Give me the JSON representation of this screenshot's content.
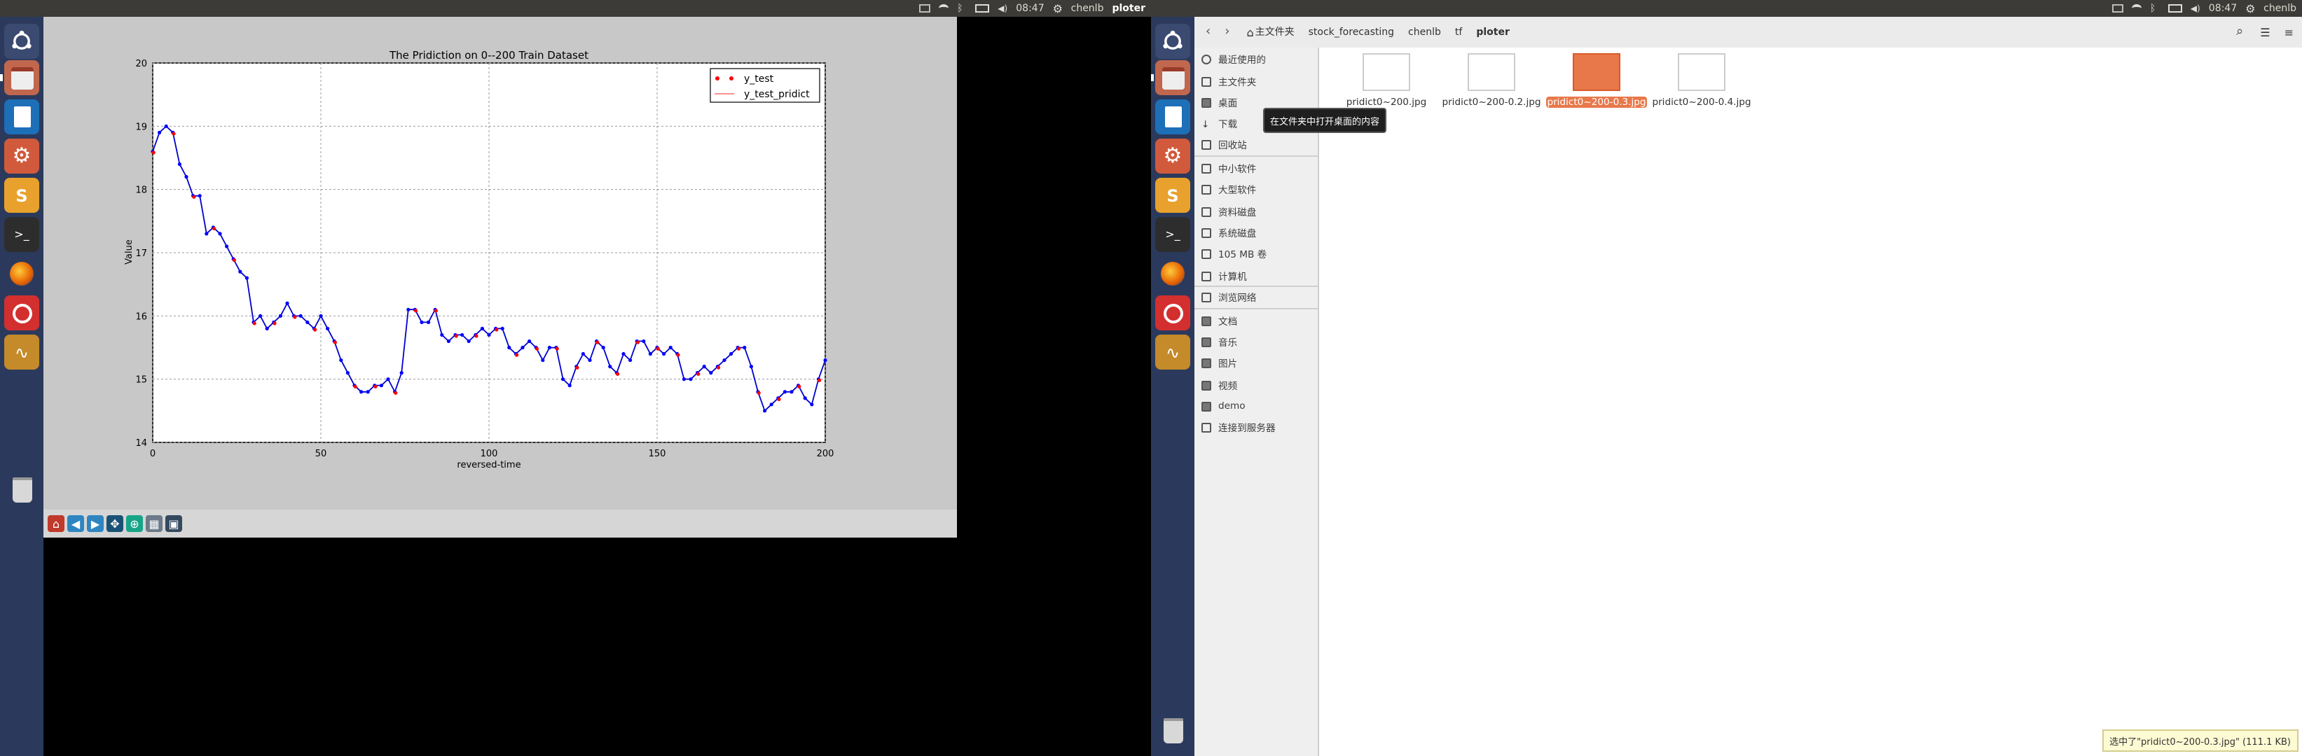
{
  "top_panel": {
    "left": {
      "time": "08:47",
      "user": "chenlb",
      "window_title": "ploter"
    },
    "right": {
      "time": "08:47",
      "user": "chenlb"
    }
  },
  "launcher_icons": [
    "ubuntu-dash-icon",
    "files-icon",
    "writer-icon",
    "settings-icon",
    "sublime-icon",
    "terminal-icon",
    "firefox-icon",
    "pencil-app-icon",
    "waveform-icon",
    "trash-icon"
  ],
  "toolbar_icons": [
    "home-icon",
    "back-icon",
    "forward-icon",
    "pan-icon",
    "zoom-icon",
    "subplots-icon",
    "save-icon"
  ],
  "file_manager": {
    "breadcrumbs": [
      "主文件夹",
      "stock_forecasting",
      "chenlb",
      "tf",
      "ploter"
    ],
    "sidebar": {
      "group1": [
        "最近使用的",
        "主文件夹",
        "桌面",
        "下载",
        "回收站"
      ],
      "group2": [
        "中小软件",
        "大型软件",
        "资料磁盘",
        "系统磁盘",
        "105 MB 卷",
        "计算机"
      ],
      "group3": [
        "浏览网络"
      ],
      "group4": [
        "文档",
        "音乐",
        "图片",
        "视频",
        "demo",
        "连接到服务器"
      ]
    },
    "files": [
      "pridict0~200.jpg",
      "pridict0~200-0.2.jpg",
      "pridict0~200-0.3.jpg",
      "pridict0~200-0.4.jpg"
    ],
    "selected_index": 2,
    "tooltip": "在文件夹中打开桌面的内容",
    "status": "选中了\"pridict0~200-0.3.jpg\" (111.1 KB)"
  },
  "chart_data": {
    "type": "line",
    "title": "The Pridiction on 0--200 Train Dataset",
    "xlabel": "reversed-time",
    "ylabel": "Value",
    "xlim": [
      0,
      200
    ],
    "ylim": [
      14,
      20
    ],
    "xticks": [
      0,
      50,
      100,
      150,
      200
    ],
    "yticks": [
      14,
      15,
      16,
      17,
      18,
      19,
      20
    ],
    "grid": true,
    "legend_position": "top-right",
    "series": [
      {
        "name": "y_test",
        "style": "red dots",
        "color": "#ff0000"
      },
      {
        "name": "y_test_pridict",
        "style": "line with blue markers",
        "color": "#0000ff"
      }
    ],
    "x": [
      0,
      2,
      4,
      6,
      8,
      10,
      12,
      14,
      16,
      18,
      20,
      22,
      24,
      26,
      28,
      30,
      32,
      34,
      36,
      38,
      40,
      42,
      44,
      46,
      48,
      50,
      52,
      54,
      56,
      58,
      60,
      62,
      64,
      66,
      68,
      70,
      72,
      74,
      76,
      78,
      80,
      82,
      84,
      86,
      88,
      90,
      92,
      94,
      96,
      98,
      100,
      102,
      104,
      106,
      108,
      110,
      112,
      114,
      116,
      118,
      120,
      122,
      124,
      126,
      128,
      130,
      132,
      134,
      136,
      138,
      140,
      142,
      144,
      146,
      148,
      150,
      152,
      154,
      156,
      158,
      160,
      162,
      164,
      166,
      168,
      170,
      172,
      174,
      176,
      178,
      180,
      182,
      184,
      186,
      188,
      190,
      192,
      194,
      196,
      198,
      200
    ],
    "values": [
      18.6,
      18.9,
      19.0,
      18.9,
      18.4,
      18.2,
      17.9,
      17.9,
      17.3,
      17.4,
      17.3,
      17.1,
      16.9,
      16.7,
      16.6,
      15.9,
      16.0,
      15.8,
      15.9,
      16.0,
      16.2,
      16.0,
      16.0,
      15.9,
      15.8,
      16.0,
      15.8,
      15.6,
      15.3,
      15.1,
      14.9,
      14.8,
      14.8,
      14.9,
      14.9,
      15.0,
      14.8,
      15.1,
      16.1,
      16.1,
      15.9,
      15.9,
      16.1,
      15.7,
      15.6,
      15.7,
      15.7,
      15.6,
      15.7,
      15.8,
      15.7,
      15.8,
      15.8,
      15.5,
      15.4,
      15.5,
      15.6,
      15.5,
      15.3,
      15.5,
      15.5,
      15.0,
      14.9,
      15.2,
      15.4,
      15.3,
      15.6,
      15.5,
      15.2,
      15.1,
      15.4,
      15.3,
      15.6,
      15.6,
      15.4,
      15.5,
      15.4,
      15.5,
      15.4,
      15.0,
      15.0,
      15.1,
      15.2,
      15.1,
      15.2,
      15.3,
      15.4,
      15.5,
      15.5,
      15.2,
      14.8,
      14.5,
      14.6,
      14.7,
      14.8,
      14.8,
      14.9,
      14.7,
      14.6,
      15.0,
      15.3
    ]
  }
}
